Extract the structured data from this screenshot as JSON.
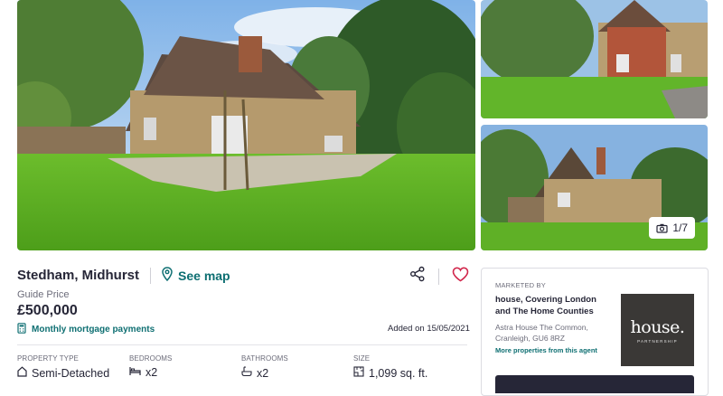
{
  "gallery": {
    "counter": "1/7",
    "icons": {
      "camera": "camera-icon"
    }
  },
  "listing": {
    "location": "Stedham, Midhurst",
    "see_map": "See map",
    "guide_label": "Guide Price",
    "price": "£500,000",
    "mortgage_link": "Monthly mortgage payments",
    "added_on": "Added on 15/05/2021",
    "icons": {
      "pin": "map-pin-icon",
      "share": "share-icon",
      "heart": "heart-icon",
      "calculator": "calculator-icon"
    }
  },
  "properties": [
    {
      "label": "PROPERTY TYPE",
      "value": "Semi-Detached",
      "icon": "house-icon"
    },
    {
      "label": "BEDROOMS",
      "value": "x2",
      "icon": "bed-icon"
    },
    {
      "label": "BATHROOMS",
      "value": "x2",
      "icon": "bath-icon"
    },
    {
      "label": "SIZE",
      "value": "1,099 sq. ft.",
      "icon": "ruler-icon"
    }
  ],
  "agent": {
    "marketed_by": "MARKETED BY",
    "name": "house, Covering London and The Home Counties",
    "address": "Astra House The Common, Cranleigh, GU6 8RZ",
    "more_link": "More properties from this agent",
    "logo_text": "house.",
    "logo_subtext": "PARTNERSHIP"
  },
  "colors": {
    "accent": "#0e6f72",
    "text": "#262637",
    "heart": "#d1264b"
  }
}
